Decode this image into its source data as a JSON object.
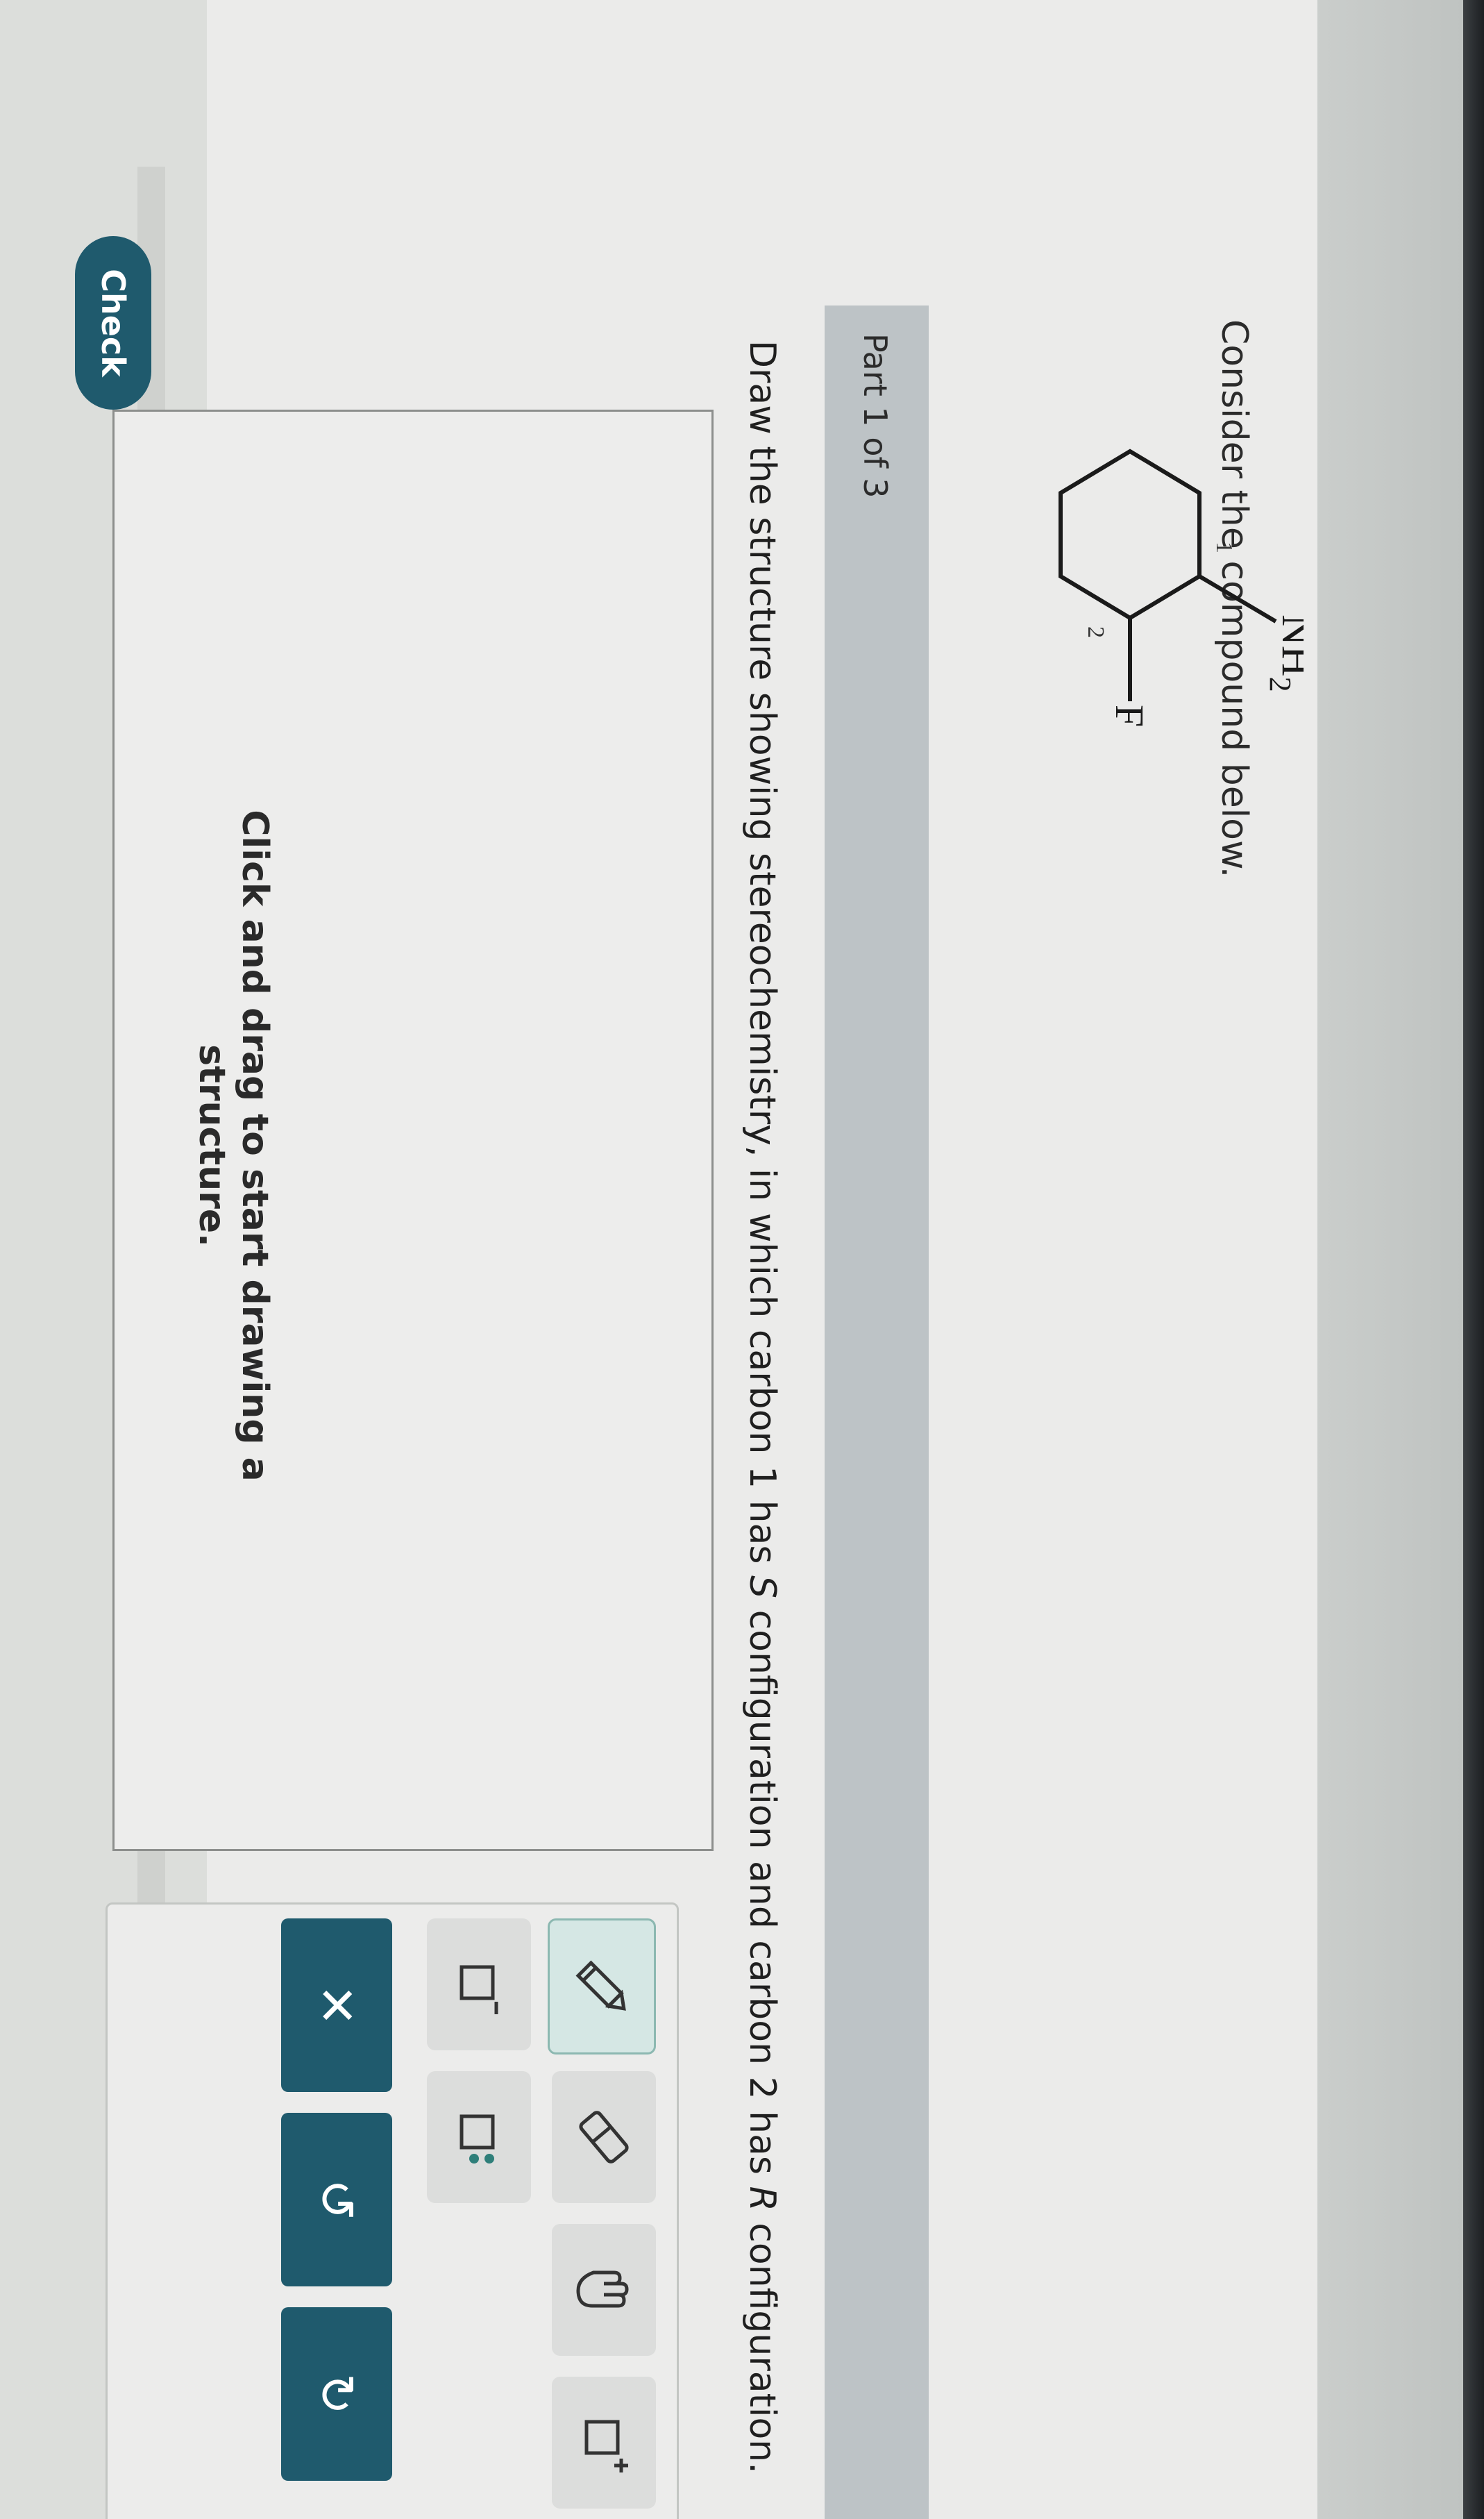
{
  "question": {
    "prompt": "Consider the compound below.",
    "molecule": {
      "substituent_1": "NH",
      "substituent_1_subscript": "2",
      "substituent_2": "F",
      "locant_1": "1",
      "locant_2": "2"
    }
  },
  "part": {
    "label": "Part 1 of 3",
    "instruction_pre": "Draw the structure showing stereochemistry, in which carbon 1 has ",
    "config_1": "S",
    "instruction_mid": " configuration and carbon 2 has ",
    "config_2": "R",
    "instruction_post": " configuration."
  },
  "canvas": {
    "hint_line1": "Click and drag to start drawing a",
    "hint_line2": "structure."
  },
  "toolbar": {
    "tools": [
      "pencil-icon",
      "eraser-icon",
      "hand-icon",
      "add-charge-icon",
      "remove-charge-icon",
      "lone-pair-icon"
    ],
    "actions": [
      "clear-icon",
      "undo-icon",
      "redo-icon"
    ],
    "accent_color": "#1f5a6d"
  },
  "check_label": "Check"
}
